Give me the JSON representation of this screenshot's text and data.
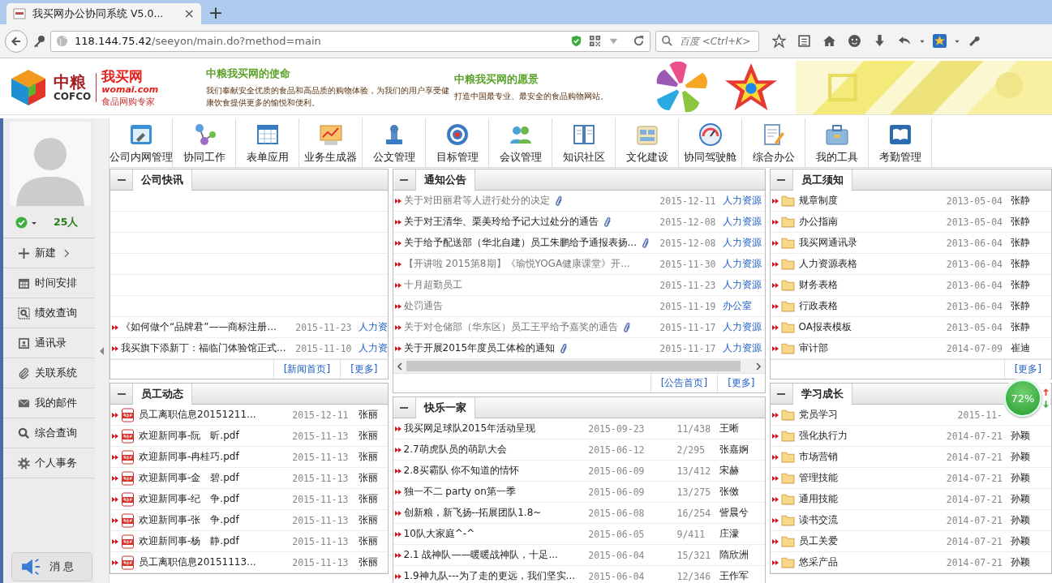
{
  "browser": {
    "tab_title": "我买网办公协同系统 V5.0...",
    "tab_close": "×",
    "new_tab": "+",
    "url_host": "118.144.75.42",
    "url_path": "/seeyon/main.do?method=main",
    "search_placeholder": "百度 <Ctrl+K>"
  },
  "banner": {
    "logo_cn": "中粮",
    "logo_en": "COFCO",
    "brand": "我买网",
    "brand_domain": "womai.com",
    "brand_slogan": "食品网购专家",
    "mission_title": "中粮我买网的使命",
    "mission_text": "我们奉献安全优质的食品和高品质的购物体验，为我们的用户享受健康饮食提供更多的愉悦和便利。",
    "vision_title": "中粮我买网的愿景",
    "vision_text": "打造中国最专业、最安全的食品购物网站。"
  },
  "user": {
    "online_count": "25人"
  },
  "sidebar": {
    "items": [
      {
        "label": "新建",
        "has_submenu": true
      },
      {
        "label": "时间安排",
        "has_submenu": false
      },
      {
        "label": "绩效查询",
        "has_submenu": false
      },
      {
        "label": "通讯录",
        "has_submenu": false
      },
      {
        "label": "关联系统",
        "has_submenu": false
      },
      {
        "label": "我的邮件",
        "has_submenu": false
      },
      {
        "label": "综合查询",
        "has_submenu": false
      },
      {
        "label": "个人事务",
        "has_submenu": false
      }
    ],
    "message_button": "消 息"
  },
  "toolbar": [
    {
      "label": "公司内网管理"
    },
    {
      "label": "协同工作"
    },
    {
      "label": "表单应用"
    },
    {
      "label": "业务生成器"
    },
    {
      "label": "公文管理"
    },
    {
      "label": "目标管理"
    },
    {
      "label": "会议管理"
    },
    {
      "label": "知识社区"
    },
    {
      "label": "文化建设"
    },
    {
      "label": "协同驾驶舱"
    },
    {
      "label": "综合办公"
    },
    {
      "label": "我的工具"
    },
    {
      "label": "考勤管理"
    }
  ],
  "columns": [
    {
      "panels": [
        {
          "title": "公司快讯",
          "kind": "news",
          "rows": [
            {
              "title": "《如何做个“品牌君”——商标注册...",
              "date": "2015-11-23",
              "source": "人力资"
            },
            {
              "title": "我买旗下添新丁：福临门体验馆正式...",
              "date": "2015-11-10",
              "source": "人力资"
            }
          ],
          "links": [
            "[新闻首页]",
            "[更多]"
          ]
        },
        {
          "title": "员工动态",
          "kind": "pdf",
          "rows": [
            {
              "title": "员工离职信息20151211...",
              "date": "2015-12-11",
              "source": "张丽"
            },
            {
              "title": "欢迎新同事-阮　昕.pdf",
              "date": "2015-11-13",
              "source": "张丽"
            },
            {
              "title": "欢迎新同事-冉桂巧.pdf",
              "date": "2015-11-13",
              "source": "张丽"
            },
            {
              "title": "欢迎新同事-金　碧.pdf",
              "date": "2015-11-13",
              "source": "张丽"
            },
            {
              "title": "欢迎新同事-纪　争.pdf",
              "date": "2015-11-13",
              "source": "张丽"
            },
            {
              "title": "欢迎新同事-张　争.pdf",
              "date": "2015-11-13",
              "source": "张丽"
            },
            {
              "title": "欢迎新同事-杨　静.pdf",
              "date": "2015-11-13",
              "source": "张丽"
            },
            {
              "title": "员工离职信息20151113...",
              "date": "2015-11-13",
              "source": "张丽"
            }
          ]
        }
      ]
    },
    {
      "panels": [
        {
          "title": "通知公告",
          "kind": "notice",
          "rows": [
            {
              "title": "关于对田丽君等人进行处分的决定",
              "read": true,
              "attachment": true,
              "date": "2015-12-11",
              "source": "人力资源"
            },
            {
              "title": "关于对王清华、栗美玲给予记大过处分的通告",
              "read": false,
              "attachment": true,
              "date": "2015-12-08",
              "source": "人力资源"
            },
            {
              "title": "关于给予配送部（华北自建）员工朱鹏给予通报表扬...",
              "read": false,
              "attachment": true,
              "date": "2015-12-08",
              "source": "人力资源"
            },
            {
              "title": "【开讲啦 2015第8期】《瑜悦YOGA健康课堂》开...",
              "read": true,
              "attachment": false,
              "date": "2015-11-30",
              "source": "人力资源"
            },
            {
              "title": "十月超勤员工",
              "read": true,
              "attachment": false,
              "date": "2015-11-23",
              "source": "人力资源"
            },
            {
              "title": "处罚通告",
              "read": true,
              "attachment": false,
              "date": "2015-11-19",
              "source": "办公室"
            },
            {
              "title": "关于对仓储部（华东区）员工王平给予嘉奖的通告",
              "read": true,
              "attachment": true,
              "date": "2015-11-17",
              "source": "人力资源"
            },
            {
              "title": "关于开展2015年度员工体检的通知",
              "read": false,
              "attachment": true,
              "date": "2015-11-17",
              "source": "人力资源"
            }
          ],
          "links": [
            "[公告首页]",
            "[更多]"
          ]
        },
        {
          "title": "快乐一家",
          "kind": "forum",
          "rows": [
            {
              "title": "我买网足球队2015年活动呈现",
              "date": "2015-09-23",
              "count": "11/438",
              "source": "王晰"
            },
            {
              "title": "2.7萌虎队员的萌趴大会",
              "date": "2015-06-12",
              "count": "2/295",
              "source": "张嘉婀"
            },
            {
              "title": "2.8买霸队 你不知道的情怀",
              "date": "2015-06-09",
              "count": "13/412",
              "source": "宋赫"
            },
            {
              "title": "独一不二 party on第一季",
              "date": "2015-06-09",
              "count": "13/275",
              "source": "张傚"
            },
            {
              "title": "创新粮，新飞扬--拓展团队1.8~",
              "date": "2015-06-08",
              "count": "16/254",
              "source": "訾晨兮"
            },
            {
              "title": "10队大家庭^-^",
              "date": "2015-06-05",
              "count": "9/411",
              "source": "庄濛"
            },
            {
              "title": "2.1 战神队——暖暖战神队，十足...",
              "date": "2015-06-04",
              "count": "15/321",
              "source": "隋欣洲"
            },
            {
              "title": "1.9神九队---为了走的更远，我们坚实...",
              "date": "2015-06-04",
              "count": "12/346",
              "source": "王作军"
            }
          ]
        }
      ]
    },
    {
      "panels": [
        {
          "title": "员工须知",
          "kind": "folder",
          "rows": [
            {
              "title": "规章制度",
              "date": "2013-05-04",
              "source": "张静"
            },
            {
              "title": "办公指南",
              "date": "2013-05-04",
              "source": "张静"
            },
            {
              "title": "我买网通讯录",
              "date": "2013-06-04",
              "source": "张静"
            },
            {
              "title": "人力资源表格",
              "date": "2013-06-04",
              "source": "张静"
            },
            {
              "title": "财务表格",
              "date": "2013-06-04",
              "source": "张静"
            },
            {
              "title": "行政表格",
              "date": "2013-06-04",
              "source": "张静"
            },
            {
              "title": "OA报表模板",
              "date": "2013-05-04",
              "source": "张静"
            },
            {
              "title": "审计部",
              "date": "2014-07-09",
              "source": "崔迪"
            }
          ],
          "links": [
            "[更多]"
          ]
        },
        {
          "title": "学习成长",
          "kind": "folder",
          "rows": [
            {
              "title": "党员学习",
              "date": "2015-11-"
            },
            {
              "title": "强化执行力",
              "date": "2014-07-21",
              "source": "孙颖"
            },
            {
              "title": "市场营销",
              "date": "2014-07-21",
              "source": "孙颖"
            },
            {
              "title": "管理技能",
              "date": "2014-07-21",
              "source": "孙颖"
            },
            {
              "title": "通用技能",
              "date": "2014-07-21",
              "source": "孙颖"
            },
            {
              "title": "读书交流",
              "date": "2014-07-21",
              "source": "孙颖"
            },
            {
              "title": "员工关爱",
              "date": "2014-07-21",
              "source": "孙颖"
            },
            {
              "title": "悠采产品",
              "date": "2014-07-21",
              "source": "孙颖"
            }
          ]
        }
      ]
    }
  ],
  "memory_widget": {
    "reading": "72%"
  }
}
